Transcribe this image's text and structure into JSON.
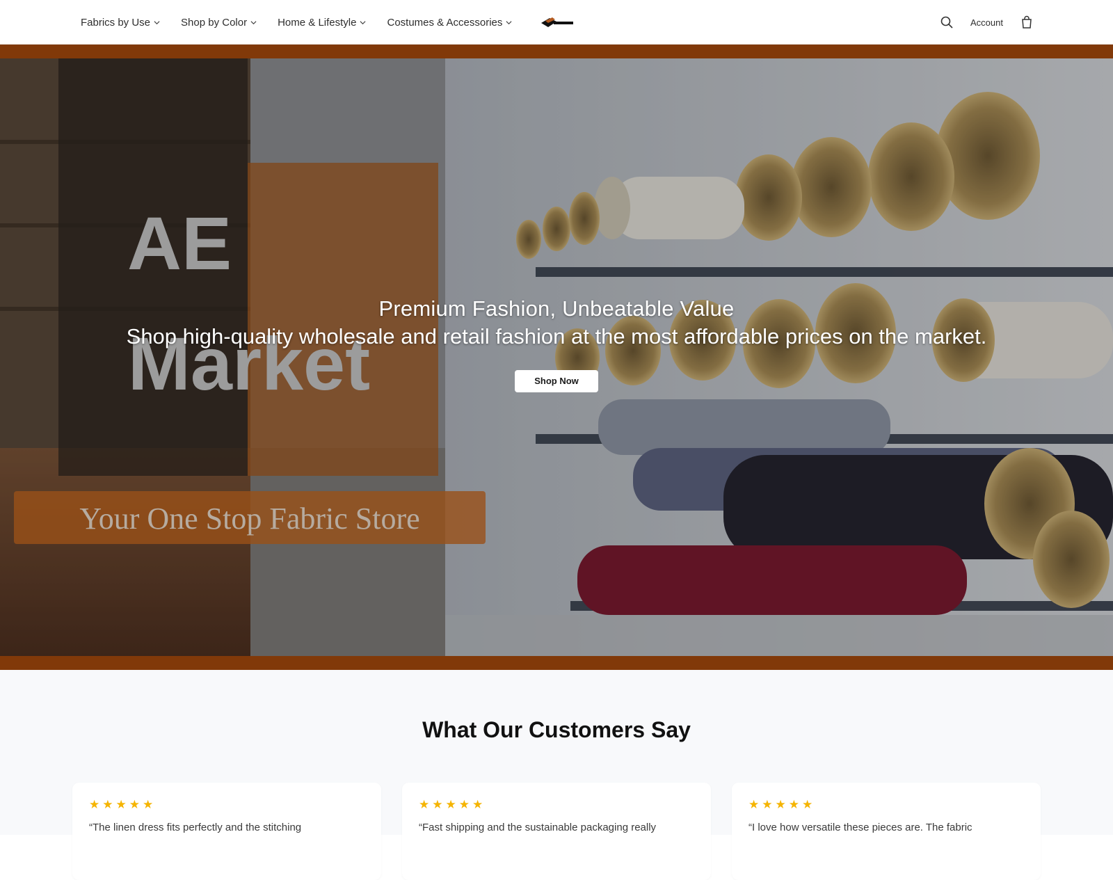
{
  "header": {
    "nav": [
      {
        "label": "Fabrics by Use"
      },
      {
        "label": "Shop by Color"
      },
      {
        "label": "Home & Lifestyle"
      },
      {
        "label": "Costumes & Accessories"
      }
    ],
    "logo_icon": "ae-market-logo",
    "search_icon": "search-icon",
    "account_label": "Account",
    "bag_icon": "shopping-bag-icon"
  },
  "hero": {
    "image_text": {
      "brand_line1": "AE",
      "brand_line2": "Market",
      "tagline": "Your One Stop Fabric Store"
    },
    "title": "Premium Fashion, Unbeatable Value",
    "subtitle": "Shop high-quality wholesale and retail fashion at the most affordable prices on the market.",
    "cta_label": "Shop Now",
    "colors": {
      "band": "#a64a0c",
      "cta_bg": "#ffffff"
    }
  },
  "testimonials": {
    "title": "What Our Customers Say",
    "items": [
      {
        "stars": "★★★★★",
        "quote": "“The linen dress fits perfectly and the stitching"
      },
      {
        "stars": "★★★★★",
        "quote": "“Fast shipping and the sustainable packaging really"
      },
      {
        "stars": "★★★★★",
        "quote": "“I love how versatile these pieces are. The fabric"
      }
    ],
    "star_color": "#f5b400"
  }
}
